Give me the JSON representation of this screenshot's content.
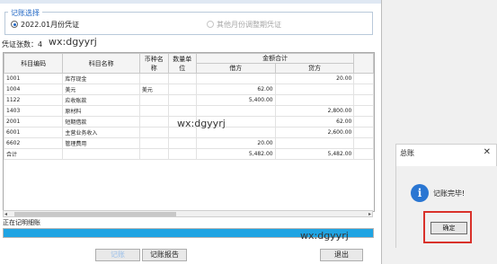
{
  "mode_group": {
    "legend": "记账选择",
    "option_current": "2022.01月份凭证",
    "option_other": "其他月份调整期凭证"
  },
  "voucher_count": "凭证张数：4",
  "table": {
    "headers": [
      "科目编码",
      "科目名称",
      "币种名称",
      "数量单位",
      "金额合计",
      "借方",
      "贷方"
    ],
    "rows": [
      [
        "1001",
        "库存现金",
        "",
        "",
        "",
        "20.00"
      ],
      [
        "1004",
        "美元",
        "美元",
        "",
        "62.00",
        ""
      ],
      [
        "1122",
        "应收账款",
        "",
        "",
        "5,400.00",
        ""
      ],
      [
        "1403",
        "原材料",
        "",
        "",
        "",
        "2,800.00"
      ],
      [
        "2001",
        "短期借款",
        "",
        "",
        "",
        "62.00"
      ],
      [
        "6001",
        "主营业务收入",
        "",
        "",
        "",
        "2,600.00"
      ],
      [
        "6602",
        "管理费用",
        "",
        "",
        "20.00",
        ""
      ],
      [
        "合计",
        "",
        "",
        "",
        "5,482.00",
        "5,482.00"
      ]
    ]
  },
  "status_text": "正在记明细账",
  "progress_fraction": 1.0,
  "buttons": {
    "post": "记账",
    "report": "记账报告",
    "exit": "退出"
  },
  "dialog": {
    "title": "总账",
    "close": "✕",
    "message": "记账完毕!",
    "ok": "确定"
  },
  "watermarks": [
    "wx:dgyyrj",
    "wx:dgyyrj",
    "wx:dgyyrj"
  ],
  "colors": {
    "accent": "#1f66c4",
    "progress": "#1fa4e3",
    "highlight": "#d9312a"
  }
}
